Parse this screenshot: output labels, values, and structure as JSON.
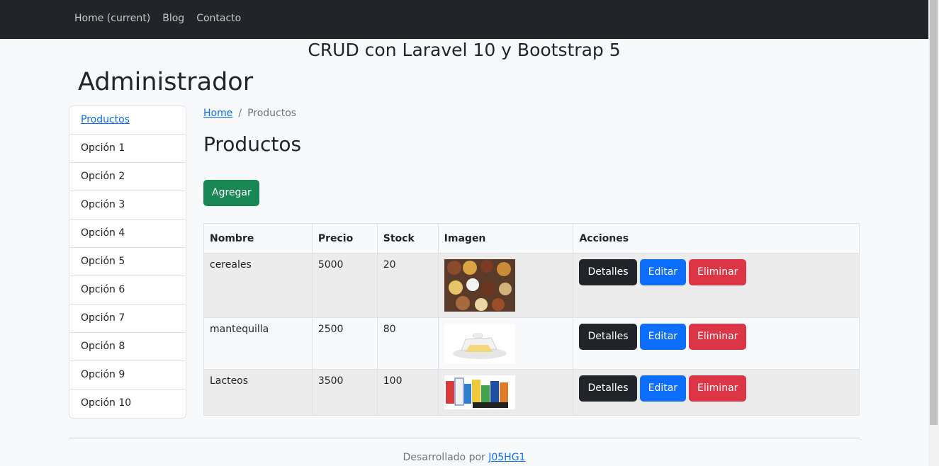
{
  "navbar": {
    "links": [
      {
        "label": "Home (current)"
      },
      {
        "label": "Blog"
      },
      {
        "label": "Contacto"
      }
    ]
  },
  "header": {
    "site_title": "CRUD con Laravel 10 y Bootstrap 5",
    "admin_title": "Administrador"
  },
  "sidebar": {
    "items": [
      {
        "label": "Productos"
      },
      {
        "label": "Opción 1"
      },
      {
        "label": "Opción 2"
      },
      {
        "label": "Opción 3"
      },
      {
        "label": "Opción 4"
      },
      {
        "label": "Opción 5"
      },
      {
        "label": "Opción 6"
      },
      {
        "label": "Opción 7"
      },
      {
        "label": "Opción 8"
      },
      {
        "label": "Opción 9"
      },
      {
        "label": "Opción 10"
      }
    ]
  },
  "breadcrumb": {
    "home": "Home",
    "separator": "/",
    "current": "Productos"
  },
  "main": {
    "title": "Productos",
    "add_label": "Agregar"
  },
  "table": {
    "headers": [
      "Nombre",
      "Precio",
      "Stock",
      "Imagen",
      "Acciones"
    ],
    "rows": [
      {
        "nombre": "cereales",
        "precio": "5000",
        "stock": "20",
        "image": "cereal-bowls-photo"
      },
      {
        "nombre": "mantequilla",
        "precio": "2500",
        "stock": "80",
        "image": "butter-dish-photo"
      },
      {
        "nombre": "Lacteos",
        "precio": "3500",
        "stock": "100",
        "image": "grocery-products-photo"
      }
    ],
    "actions": {
      "details": "Detalles",
      "edit": "Editar",
      "delete": "Eliminar"
    }
  },
  "footer": {
    "text": "Desarrollado por",
    "author": "J05HG1"
  },
  "colors": {
    "navbar": "#212529",
    "success": "#198754",
    "primary": "#0d6efd",
    "danger": "#dc3545",
    "dark": "#212529"
  }
}
